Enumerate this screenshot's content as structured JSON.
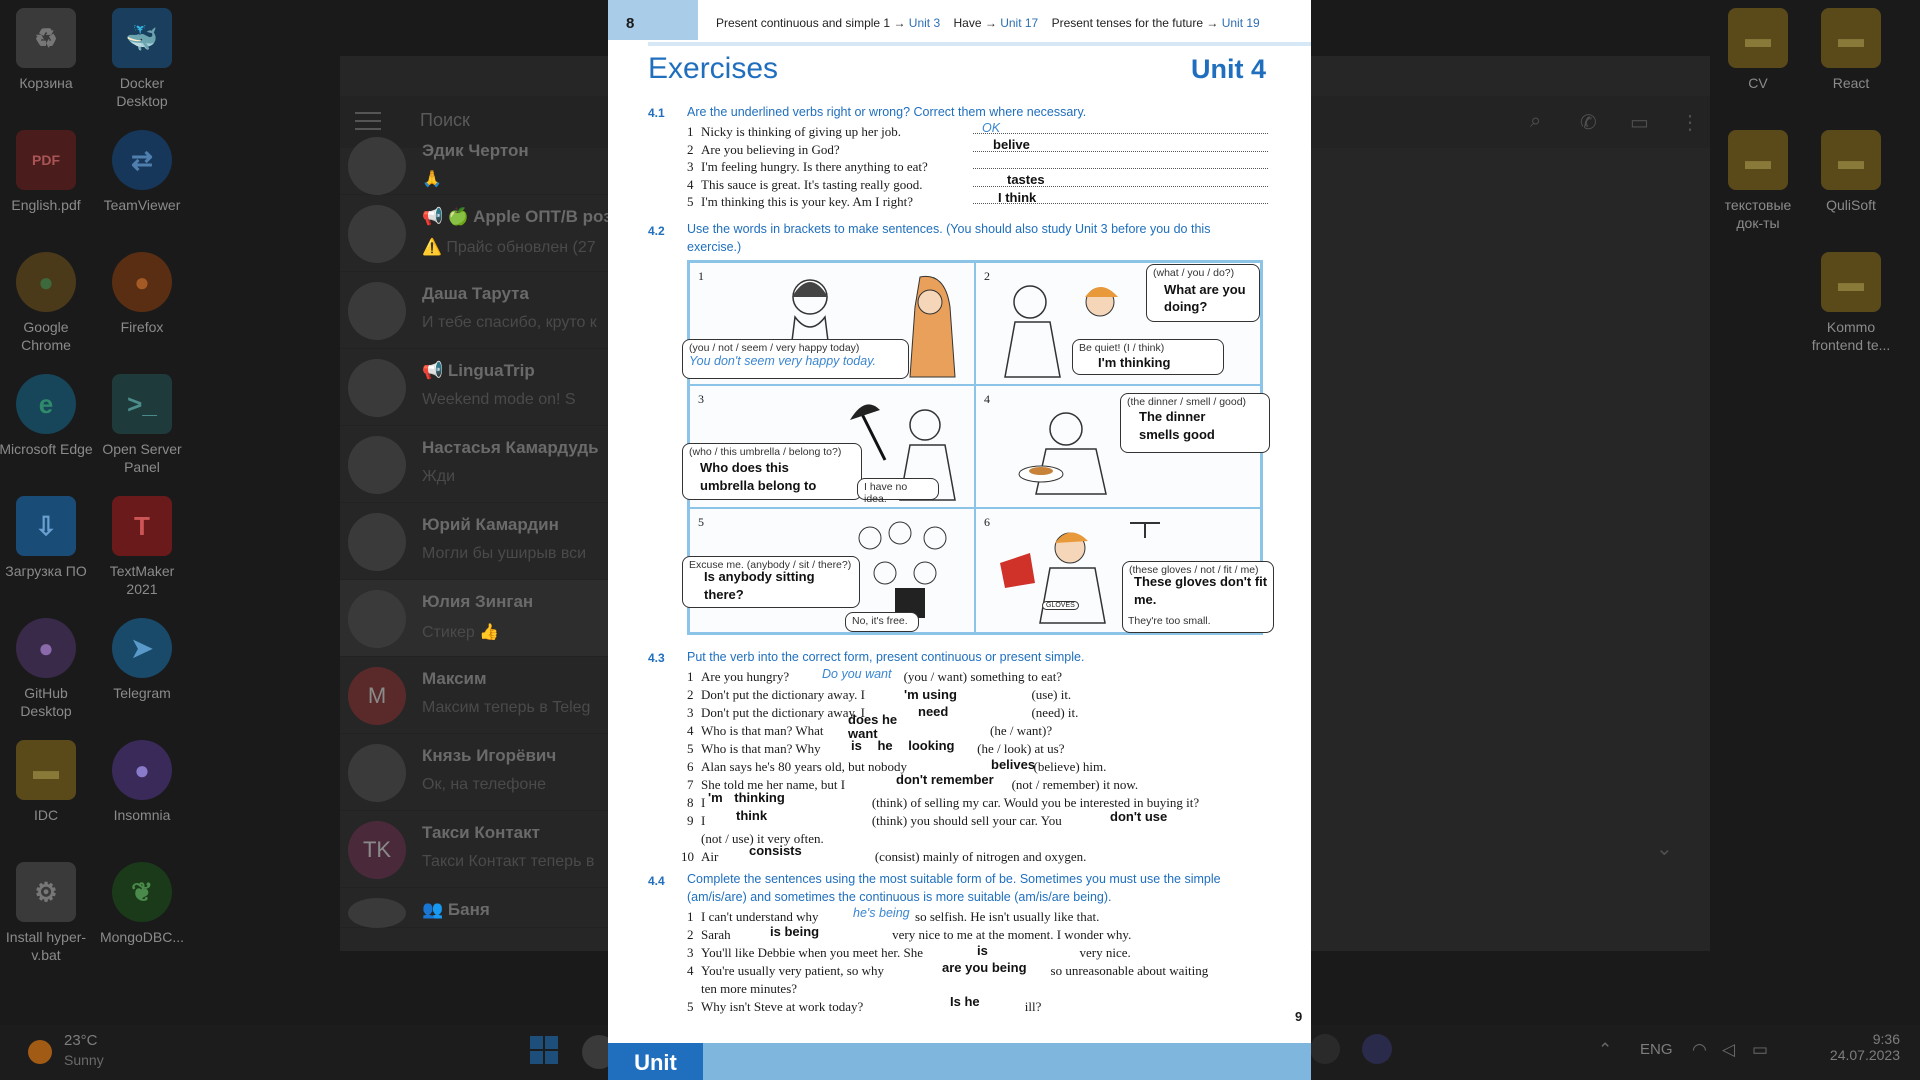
{
  "desktop": {
    "left_icons": [
      {
        "label": "Корзина",
        "icon": "recycle-bin-icon"
      },
      {
        "label": "Docker Desktop",
        "icon": "docker-icon"
      },
      {
        "label": "English.pdf",
        "icon": "pdf-icon"
      },
      {
        "label": "TeamViewer",
        "icon": "teamviewer-icon"
      },
      {
        "label": "Google Chrome",
        "icon": "chrome-icon"
      },
      {
        "label": "Firefox",
        "icon": "firefox-icon"
      },
      {
        "label": "Microsoft Edge",
        "icon": "edge-icon"
      },
      {
        "label": "Open Server Panel",
        "icon": "open-server-icon"
      },
      {
        "label": "Загрузка ПО",
        "icon": "download-icon"
      },
      {
        "label": "TextMaker 2021",
        "icon": "textmaker-icon"
      },
      {
        "label": "GitHub Desktop",
        "icon": "github-icon"
      },
      {
        "label": "Telegram",
        "icon": "telegram-icon"
      },
      {
        "label": "IDC",
        "icon": "folder-icon"
      },
      {
        "label": "Insomnia",
        "icon": "insomnia-icon"
      },
      {
        "label": "Install hyper-v.bat",
        "icon": "gear-file-icon"
      },
      {
        "label": "MongoDBC...",
        "icon": "mongodb-icon"
      }
    ],
    "right_icons": [
      {
        "label": "CV",
        "icon": "folder-icon"
      },
      {
        "label": "React",
        "icon": "folder-icon"
      },
      {
        "label": "текстовые док-ты",
        "icon": "folder-icon"
      },
      {
        "label": "QuliSoft",
        "icon": "folder-icon"
      },
      {
        "label": "Kommo frontend te...",
        "icon": "folder-icon"
      }
    ]
  },
  "telegram": {
    "search_placeholder": "Поиск",
    "chats": [
      {
        "name": "Эдик Чертон",
        "preview": "🙏",
        "avatar": ""
      },
      {
        "name": "📢 🍏 Apple ОПТ/В розн",
        "preview": "⚠️ Прайс обновлен (27",
        "avatar": ""
      },
      {
        "name": "Даша Тарута",
        "preview": "И тебе спасибо, круто к",
        "avatar": ""
      },
      {
        "name": "📢 LinguaTrip",
        "preview": "Weekend mode on! S",
        "avatar": ""
      },
      {
        "name": "Настасья Камардудь",
        "preview": "Жди",
        "avatar": ""
      },
      {
        "name": "Юрий Камардин",
        "preview": "Могли бы уширыв вси",
        "avatar": ""
      },
      {
        "name": "Юлия Зинган",
        "preview": "Стикер 👍",
        "avatar": ""
      },
      {
        "name": "Максим",
        "preview": "Максим теперь в Teleg",
        "avatar": "M"
      },
      {
        "name": "Князь Игорёвич",
        "preview": "Ок, на телефоне",
        "avatar": ""
      },
      {
        "name": "Такси Контакт",
        "preview": "Такси Контакт теперь в",
        "avatar": "TK"
      },
      {
        "name": "👥 Баня",
        "preview": "",
        "avatar": ""
      }
    ]
  },
  "taskbar": {
    "temperature": "23°C",
    "condition": "Sunny",
    "language": "ENG",
    "time": "9:36",
    "date": "24.07.2023"
  },
  "book": {
    "page_number": "8",
    "cross_ref": {
      "t1": "Present continuous and simple 1 →",
      "u1": "Unit 3",
      "t2": "Have →",
      "u2": "Unit 17",
      "t3": "Present tenses for the future →",
      "u3": "Unit 19"
    },
    "title": "Exercises",
    "unit": "Unit 4",
    "bottom_page": "9",
    "bottom_unit": "Unit",
    "ex41": {
      "num": "4.1",
      "instr": "Are the underlined verbs right or wrong? Correct them where necessary.",
      "lines": [
        {
          "n": "1",
          "text": "Nicky is thinking of giving up her job.",
          "sample": "OK",
          "answer": ""
        },
        {
          "n": "2",
          "text": "Are you believing in God?",
          "sample": "",
          "answer": "belive"
        },
        {
          "n": "3",
          "text": "I'm feeling hungry. Is there anything to eat?",
          "sample": "",
          "answer": ""
        },
        {
          "n": "4",
          "text": "This sauce is great. It's tasting really good.",
          "sample": "",
          "answer": "tastes"
        },
        {
          "n": "5",
          "text": "I'm thinking this is your key. Am I right?",
          "sample": "",
          "answer": "I think"
        }
      ]
    },
    "ex42": {
      "num": "4.2",
      "instr": "Use the words in brackets to make sentences. (You should also study Unit 3 before you do this exercise.)",
      "cells": [
        {
          "n": "1",
          "hint": "(you / not / seem / very happy today)",
          "answer": "You don't seem very happy today.",
          "reply": ""
        },
        {
          "n": "2",
          "hint": "(what / you / do?)",
          "answer": "What are you doing?",
          "hint2": "Be quiet! (I / think)",
          "answer2": "I'm thinking"
        },
        {
          "n": "3",
          "hint": "(who / this umbrella / belong to?)",
          "answer": "Who does this umbrella belong to",
          "reply": "I have no idea."
        },
        {
          "n": "4",
          "hint": "(the dinner / smell / good)",
          "answer": "The dinner smells good",
          "reply": ""
        },
        {
          "n": "5",
          "hint": "Excuse me. (anybody / sit / there?)",
          "answer": "Is anybody sitting there?",
          "reply": "No, it's free."
        },
        {
          "n": "6",
          "hint": "(these gloves / not / fit / me)",
          "answer": "These gloves don't fit me.",
          "reply": "They're too small.",
          "tag": "GLOVES"
        }
      ]
    },
    "ex43": {
      "num": "4.3",
      "instr": "Put the verb into the correct form, present continuous or present simple.",
      "lines": [
        {
          "n": "1",
          "a": "Are you hungry?",
          "b": "(you / want) something to eat?",
          "sample": "Do you want"
        },
        {
          "n": "2",
          "a": "Don't put the dictionary away. I",
          "b": "(use) it.",
          "answer": "'m using"
        },
        {
          "n": "3",
          "a": "Don't put the dictionary away. I",
          "b": "(need) it.",
          "answer": "need"
        },
        {
          "n": "4",
          "a": "Who is that man? What",
          "b": "(he / want)?",
          "answer": "does he want"
        },
        {
          "n": "5",
          "a": "Who is that man? Why",
          "b": "(he / look) at us?",
          "answer": "is he looking"
        },
        {
          "n": "6",
          "a": "Alan says he's 80 years old, but nobody",
          "b": "(believe) him.",
          "answer": "belives"
        },
        {
          "n": "7",
          "a": "She told me her name, but I",
          "b": "(not / remember) it now.",
          "answer": "don't remember"
        },
        {
          "n": "8",
          "a": "I",
          "b": "(think) of selling my car. Would you be interested in buying it?",
          "answer": "'m thinking"
        },
        {
          "n": "9",
          "a": "I",
          "b": "(think) you should sell your car. You",
          "answer": "think",
          "answer2": "don't use"
        },
        {
          "n": "",
          "a": "(not / use) it very often.",
          "b": ""
        },
        {
          "n": "10",
          "a": "Air",
          "b": "(consist) mainly of nitrogen and oxygen.",
          "answer": "consists"
        }
      ]
    },
    "ex44": {
      "num": "4.4",
      "instr": "Complete the sentences using the most suitable form of be. Sometimes you must use the simple (am/is/are) and sometimes the continuous is more suitable (am/is/are being).",
      "lines": [
        {
          "n": "1",
          "a": "I can't understand why",
          "b": "so selfish. He isn't usually like that.",
          "sample": "he's being"
        },
        {
          "n": "2",
          "a": "Sarah",
          "b": "very nice to me at the moment. I wonder why.",
          "answer": "is being"
        },
        {
          "n": "3",
          "a": "You'll like Debbie when you meet her. She",
          "b": "very nice.",
          "answer": "is"
        },
        {
          "n": "4",
          "a": "You're usually very patient, so why",
          "b": "so unreasonable about waiting",
          "answer": "are you being"
        },
        {
          "n": "",
          "a": "ten more minutes?",
          "b": ""
        },
        {
          "n": "5",
          "a": "Why isn't Steve at work today?",
          "b": "ill?",
          "answer": "Is he"
        }
      ]
    }
  }
}
